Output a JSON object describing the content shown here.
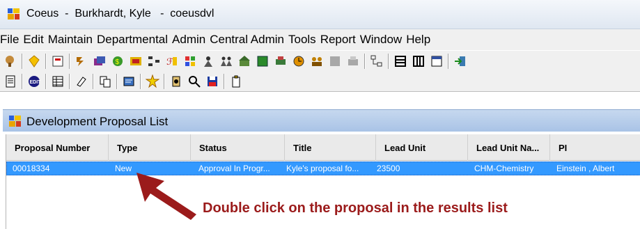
{
  "window": {
    "title": "Coeus  -  Burkhardt, Kyle   -  coeusdvl",
    "icon": "coeus-app-icon"
  },
  "menu": [
    "File",
    "Edit",
    "Maintain",
    "Departmental",
    "Admin",
    "Central Admin",
    "Tools",
    "Report",
    "Window",
    "Help"
  ],
  "toolbar_icons_row1": [
    "proposal-icon",
    "award-icon",
    "budget-icon",
    "subcontract-icon",
    "negotiation-icon",
    "money-icon",
    "rolodex-icon",
    "organization-icon",
    "sponsor-icon",
    "people-icon",
    "person-icon",
    "persons-icon",
    "unit-icon",
    "report-icon",
    "print-icon",
    "clock-icon",
    "group-icon",
    "disabled-icon-1",
    "disabled-icon-2",
    "hierarchy-icon",
    "list-icon",
    "columns-icon",
    "form-icon",
    "exit-icon"
  ],
  "toolbar_icons_row2": [
    "document-icon",
    "edit-icon",
    "grid-icon",
    "eraser-icon",
    "copy-icon",
    "notes-icon",
    "star-icon",
    "documents-icon",
    "search-icon",
    "save-icon",
    "clipboard-icon"
  ],
  "child_window": {
    "title": "Development Proposal List",
    "icon": "coeus-app-icon"
  },
  "table": {
    "columns": [
      "Proposal Number",
      "Type",
      "Status",
      "Title",
      "Lead Unit",
      "Lead Unit Na...",
      "PI"
    ],
    "rows": [
      {
        "proposal_number": "00018334",
        "type": "New",
        "status": "Approval In Progr...",
        "title": "Kyle's proposal fo...",
        "lead_unit": "23500",
        "lead_unit_name": "CHM-Chemistry",
        "pi": "Einstein ,  Albert"
      }
    ],
    "selected_row_color": "#3399ff"
  },
  "annotation": {
    "text": "Double click on the proposal in the results list",
    "color": "#9b1b1b"
  }
}
